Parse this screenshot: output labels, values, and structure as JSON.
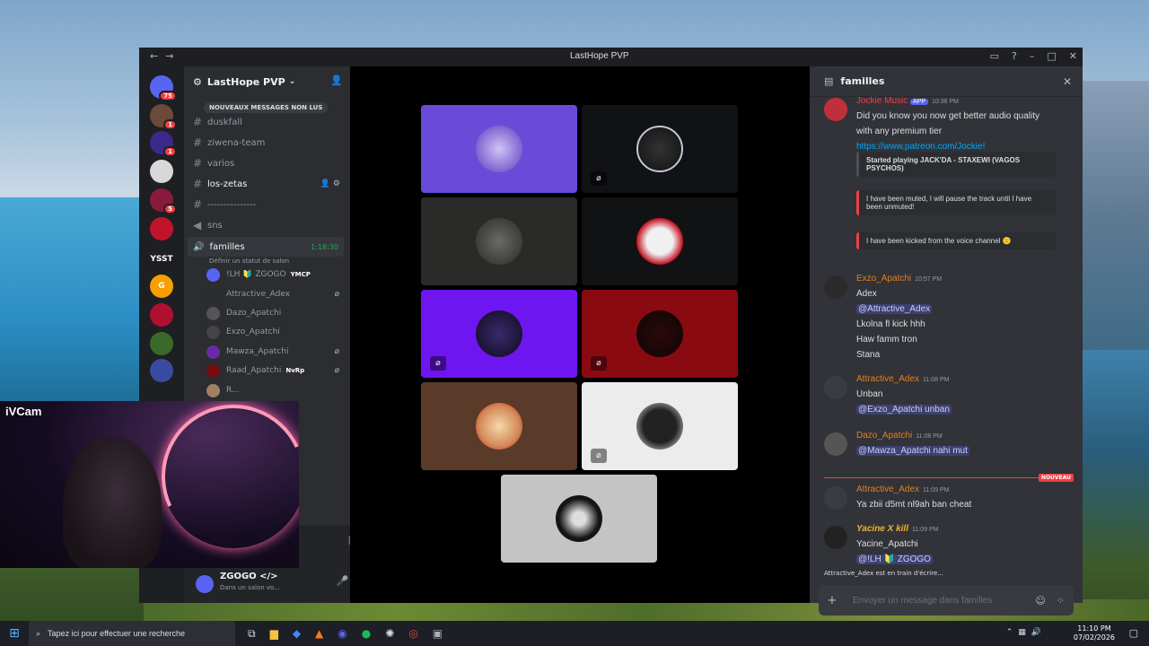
{
  "window": {
    "title": "LastHope PVP"
  },
  "servers": [
    {
      "label": "",
      "badge": "75",
      "color": "#5865f2"
    },
    {
      "label": "",
      "badge": "1",
      "color": "#6b4a3a"
    },
    {
      "label": "",
      "badge": "1",
      "color": "#3b2a8a"
    },
    {
      "label": "",
      "badge": "",
      "color": "#d8d8d8"
    },
    {
      "label": "",
      "badge": "5",
      "color": "#8a1a3a"
    },
    {
      "label": "",
      "badge": "",
      "color": "#c0142a"
    },
    {
      "label": "YSST",
      "badge": "",
      "color": "#1e1f22"
    },
    {
      "label": "G",
      "badge": "",
      "color": "#f5a000"
    },
    {
      "label": "",
      "badge": "",
      "color": "#b01030"
    },
    {
      "label": "",
      "badge": "",
      "color": "#3a6a2a"
    },
    {
      "label": "",
      "badge": "",
      "color": "#3a4aa0"
    }
  ],
  "server": {
    "name": "LastHope PVP",
    "new_messages": "NOUVEAUX MESSAGES NON LUS"
  },
  "channels": [
    {
      "name": "duskfall"
    },
    {
      "name": "ziwena-team"
    },
    {
      "name": "varios"
    },
    {
      "name": "los-zetas"
    },
    {
      "name": "---------------"
    },
    {
      "name": "sns"
    }
  ],
  "voice_channel": {
    "name": "familles",
    "time": "1:18:30",
    "status": "Définir un statut de salon"
  },
  "members": [
    {
      "name": "!LH 🔰 ZGOGO",
      "tag": "YMCP",
      "color": "#5865f2"
    },
    {
      "name": "Attractive_Adex",
      "tag": "",
      "color": "#2b2d31"
    },
    {
      "name": "Dazo_Apatchi",
      "tag": "",
      "color": "#555"
    },
    {
      "name": "Exzo_Apatchi",
      "tag": "",
      "color": "#444"
    },
    {
      "name": "Mawza_Apatchi",
      "tag": "",
      "color": "#6a2aa8"
    },
    {
      "name": "Raad_Apatchi",
      "tag": "NvRp",
      "color": "#7a0a12"
    },
    {
      "name": "R...",
      "tag": "",
      "color": "#a08060"
    }
  ],
  "user": {
    "name": "ZGOGO </>",
    "status": "Dans un salon vo..."
  },
  "chat": {
    "channel": "familles",
    "messages": [
      {
        "author": "Jockie Music",
        "badge": "APP",
        "time": "10:36 PM",
        "lines": [
          "Did you know you now get better audio quality",
          "with any premium tier"
        ],
        "link": "https://www.patreon.com/Jockie!"
      },
      {
        "author": "Exzo_Apatchi",
        "time": "10:57 PM",
        "lines": [
          "Adex",
          "@Attractive_Adex",
          "Lkolna fl kick hhh",
          "Haw famm tron",
          "Stana"
        ]
      },
      {
        "author": "Attractive_Adex",
        "time": "11:08 PM",
        "lines": [
          "Unban",
          "@Exzo_Apatchi unban"
        ]
      },
      {
        "author": "Dazo_Apatchi",
        "time": "11:08 PM",
        "lines": [
          "@Mawza_Apatchi nahi mut"
        ]
      },
      {
        "author": "Attractive_Adex",
        "time": "11:09 PM",
        "lines": [
          "Ya zbii d5mt nl9ah ban cheat"
        ]
      },
      {
        "author": "Yacine X kill",
        "time": "11:09 PM",
        "lines": [
          "Yacine_Apatchi",
          "@!LH 🔰 ZGOGO"
        ]
      }
    ],
    "embeds": [
      "Started playing JACK'DA - STAXEWI (VAGOS PSYCHOS)",
      "I have been muted, I will pause the track until I have been unmuted!",
      "I have been kicked from the voice channel 🙁"
    ],
    "new_label": "NOUVEAU",
    "typing": "Attractive_Adex est en train d'écrire...",
    "placeholder": "Envoyer un message dans familles"
  },
  "webcam": {
    "label": "iVCam"
  },
  "taskbar": {
    "search": "Tapez ici pour effectuer une recherche",
    "time": "11:10 PM",
    "date": "07/02/2026"
  }
}
